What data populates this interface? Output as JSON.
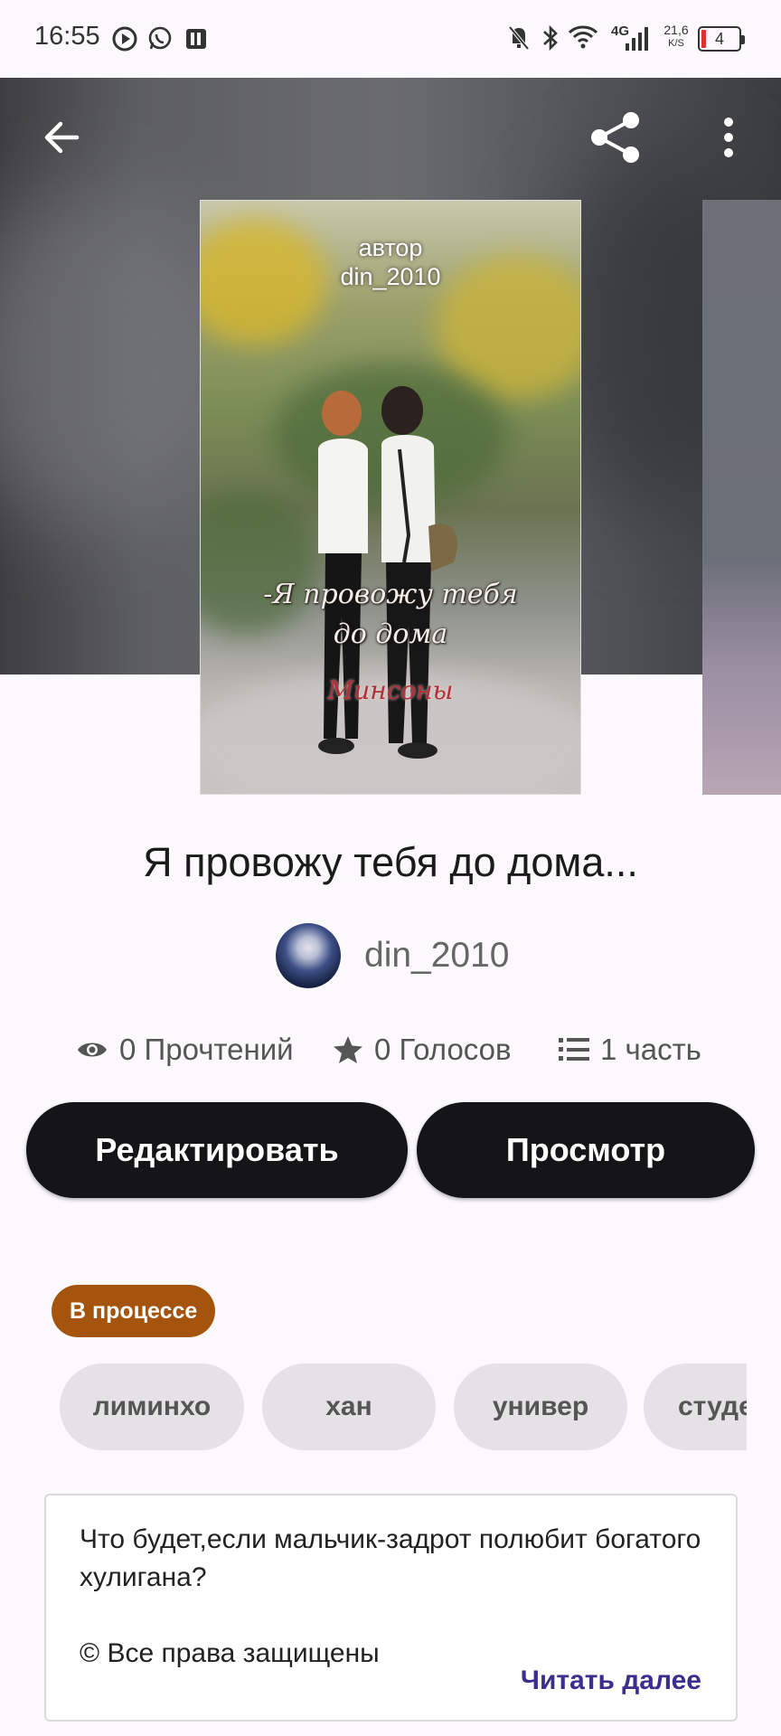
{
  "status_bar": {
    "time": "16:55",
    "network": "4G",
    "speed_value": "21,6",
    "speed_unit": "K/S",
    "battery": "4",
    "icons": [
      "play-icon",
      "whatsapp-icon",
      "reader-icon",
      "mute-icon",
      "bluetooth-icon",
      "wifi-icon",
      "signal-icon",
      "battery-icon"
    ]
  },
  "toolbar": {
    "back_icon": "arrow-left-icon",
    "share_icon": "share-icon",
    "menu_icon": "more-vertical-icon"
  },
  "cover": {
    "author_label": "автор",
    "author_name": "din_2010",
    "title_line1": "-Я провожу тебя",
    "title_line2": "до дома",
    "subtitle": "Минсоны"
  },
  "book": {
    "title": "Я провожу тебя до дома...",
    "author": "din_2010",
    "stats": {
      "reads": "0 Прочтений",
      "votes": "0 Голосов",
      "parts": "1 часть"
    }
  },
  "actions": {
    "edit_label": "Редактировать",
    "preview_label": "Просмотр"
  },
  "status_badge": "В процессе",
  "tags": [
    "лиминхо",
    "хан",
    "универ",
    "студе"
  ],
  "description": {
    "text": "Что будет,если мальчик-задрот полюбит богатого хулигана?\n\n© Все права защищены",
    "read_more": "Читать далее"
  },
  "colors": {
    "button_bg": "#151417",
    "status_chip": "#a4540c",
    "read_more": "#3a2e8f",
    "tag_bg": "#e4e2e5"
  }
}
